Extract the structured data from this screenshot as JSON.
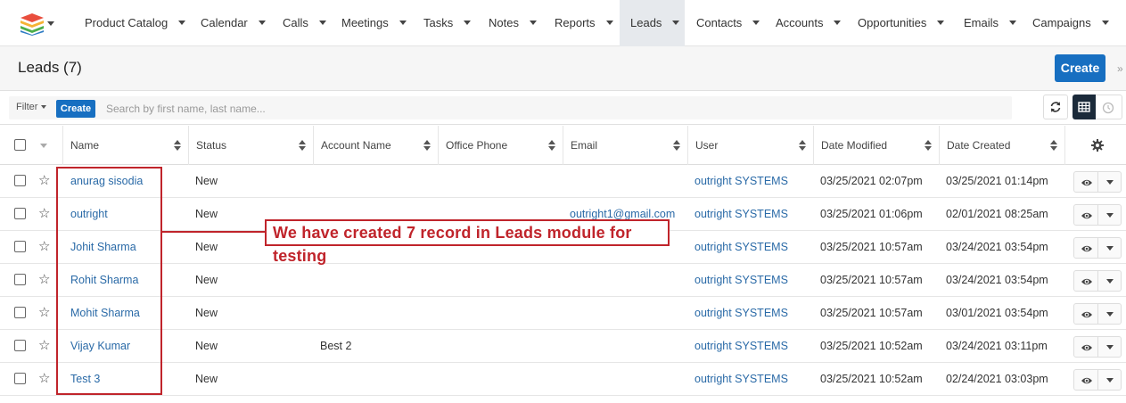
{
  "nav": {
    "items": [
      {
        "label": "Product Catalog"
      },
      {
        "label": "Calendar"
      },
      {
        "label": "Calls"
      },
      {
        "label": "Meetings"
      },
      {
        "label": "Tasks"
      },
      {
        "label": "Notes"
      },
      {
        "label": "Reports"
      },
      {
        "label": "Leads",
        "active": true
      },
      {
        "label": "Contacts"
      },
      {
        "label": "Accounts"
      },
      {
        "label": "Opportunities"
      },
      {
        "label": "Emails"
      },
      {
        "label": "Campaigns"
      }
    ],
    "logo_icon": "sugar-cube-logo-icon"
  },
  "header": {
    "title": "Leads (7)",
    "create_label": "Create",
    "expand_icon": "double-chevron-right-icon"
  },
  "filter": {
    "filter_label": "Filter",
    "create_label": "Create",
    "search_placeholder": "Search by first name, last name...",
    "icons": [
      "refresh-icon",
      "table-view-icon",
      "activity-stream-icon"
    ]
  },
  "table": {
    "columns": [
      "Name",
      "Status",
      "Account Name",
      "Office Phone",
      "Email",
      "User",
      "Date Modified",
      "Date Created"
    ],
    "rows": [
      {
        "name": "anurag sisodia",
        "status": "New",
        "account": "",
        "phone": "",
        "email": "",
        "user": "outright SYSTEMS",
        "modified": "03/25/2021 02:07pm",
        "created": "03/25/2021 01:14pm"
      },
      {
        "name": "outright",
        "status": "New",
        "account": "",
        "phone": "",
        "email": "outright1@gmail.com",
        "user": "outright SYSTEMS",
        "modified": "03/25/2021 01:06pm",
        "created": "02/01/2021 08:25am"
      },
      {
        "name": "Johit Sharma",
        "status": "New",
        "account": "",
        "phone": "",
        "email": "",
        "user": "outright SYSTEMS",
        "modified": "03/25/2021 10:57am",
        "created": "03/24/2021 03:54pm"
      },
      {
        "name": "Rohit Sharma",
        "status": "New",
        "account": "",
        "phone": "",
        "email": "",
        "user": "outright SYSTEMS",
        "modified": "03/25/2021 10:57am",
        "created": "03/24/2021 03:54pm"
      },
      {
        "name": "Mohit Sharma",
        "status": "New",
        "account": "",
        "phone": "",
        "email": "",
        "user": "outright SYSTEMS",
        "modified": "03/25/2021 10:57am",
        "created": "03/01/2021 03:54pm"
      },
      {
        "name": "Vijay Kumar",
        "status": "New",
        "account": "Best 2",
        "phone": "",
        "email": "",
        "user": "outright SYSTEMS",
        "modified": "03/25/2021 10:52am",
        "created": "03/24/2021 03:11pm"
      },
      {
        "name": "Test 3",
        "status": "New",
        "account": "",
        "phone": "",
        "email": "",
        "user": "outright SYSTEMS",
        "modified": "03/25/2021 10:52am",
        "created": "02/24/2021 03:03pm"
      }
    ]
  },
  "annotation": {
    "text": "We have created 7 record in Leads module for testing",
    "color": "#c0242b"
  },
  "colors": {
    "primary_button": "#176fc1",
    "link": "#2a6aa7",
    "active_nav": "#e6e9ed"
  }
}
